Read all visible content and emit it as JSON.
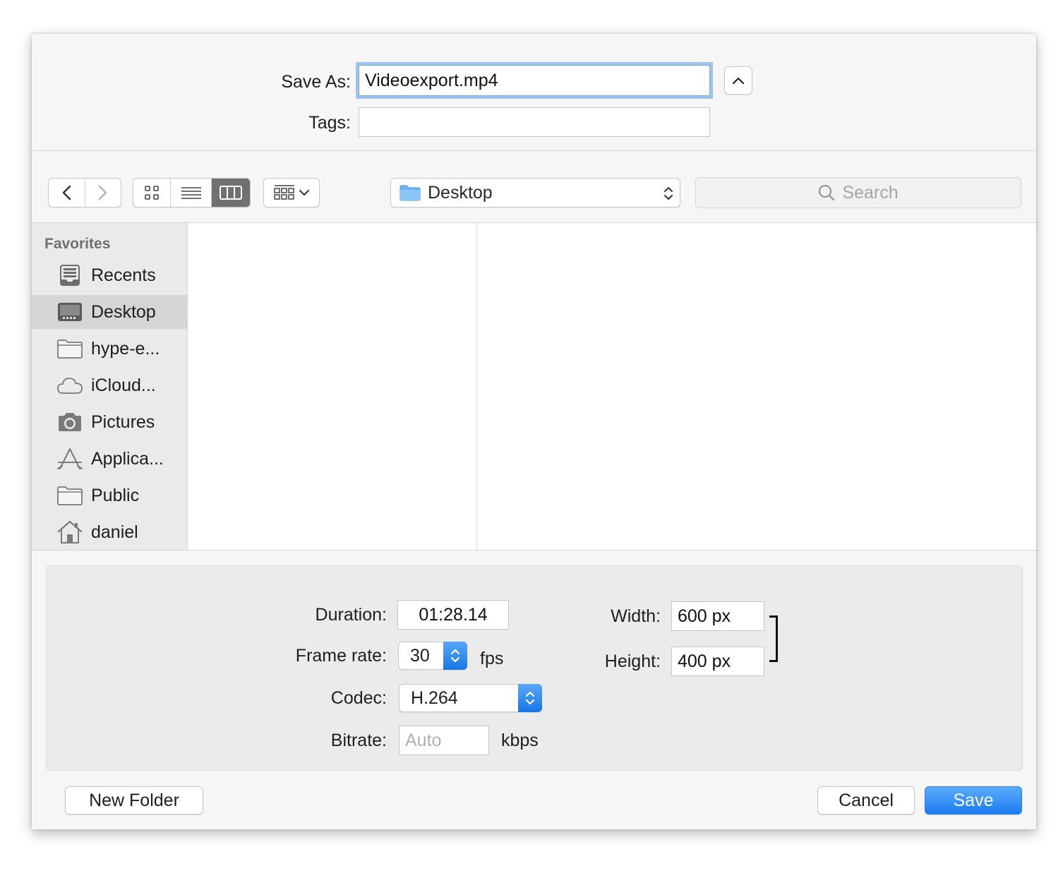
{
  "header": {
    "save_as_label": "Save As:",
    "save_as_value": "Videoexport.mp4",
    "tags_label": "Tags:",
    "tags_value": ""
  },
  "toolbar": {
    "location": "Desktop",
    "search_placeholder": "Search",
    "view_modes": [
      "icon-view",
      "list-view",
      "column-view"
    ],
    "active_view": "column-view"
  },
  "sidebar": {
    "heading": "Favorites",
    "items": [
      {
        "label": "Recents",
        "icon": "recents-icon"
      },
      {
        "label": "Desktop",
        "icon": "desktop-icon",
        "selected": true
      },
      {
        "label": "hype-e...",
        "icon": "folder-icon"
      },
      {
        "label": "iCloud...",
        "icon": "cloud-icon"
      },
      {
        "label": "Pictures",
        "icon": "camera-icon"
      },
      {
        "label": "Applica...",
        "icon": "applications-icon"
      },
      {
        "label": "Public",
        "icon": "folder-icon"
      },
      {
        "label": "daniel",
        "icon": "home-icon"
      }
    ]
  },
  "options": {
    "duration_label": "Duration:",
    "duration_value": "01:28.14",
    "frame_rate_label": "Frame rate:",
    "frame_rate_value": "30",
    "frame_rate_unit": "fps",
    "codec_label": "Codec:",
    "codec_value": "H.264",
    "bitrate_label": "Bitrate:",
    "bitrate_placeholder": "Auto",
    "bitrate_unit": "kbps",
    "width_label": "Width:",
    "width_value": "600 px",
    "height_label": "Height:",
    "height_value": "400 px"
  },
  "footer": {
    "new_folder_label": "New Folder",
    "cancel_label": "Cancel",
    "save_label": "Save"
  },
  "colors": {
    "accent": "#1b7cf0",
    "focus_ring": "#9ec3ee",
    "sidebar_bg": "#eaeaea",
    "selected_bg": "#d5d5d5"
  }
}
